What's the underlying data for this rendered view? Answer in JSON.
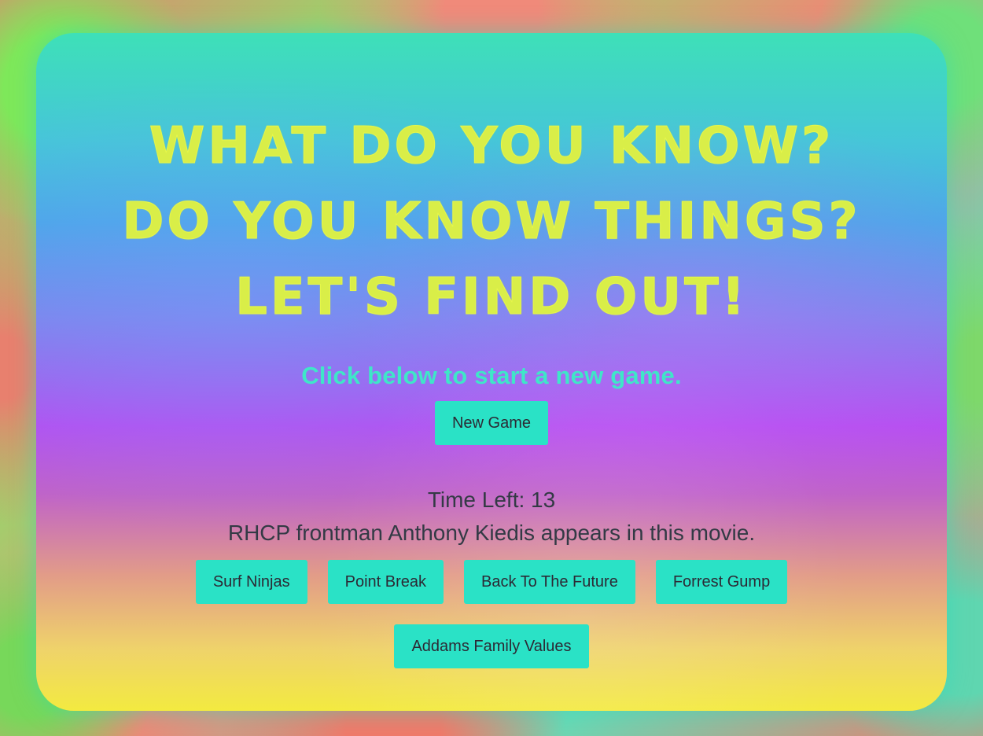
{
  "headline": {
    "line1": "WHAT DO YOU KNOW?",
    "line2": "DO YOU KNOW THINGS?",
    "line3": "LET'S FIND OUT!"
  },
  "subtitle": "Click below to start a new game.",
  "new_game_label": "New Game",
  "timer": {
    "label": "Time Left: 13"
  },
  "question": "RHCP frontman Anthony Kiedis appears in this movie.",
  "answers": [
    "Surf Ninjas",
    "Point Break",
    "Back To The Future",
    "Forrest Gump",
    "Addams Family Values"
  ],
  "colors": {
    "headline": "#d9ee48",
    "subtitle": "#3fe6c8",
    "button": "#2ae2c6",
    "text": "#333a45"
  }
}
